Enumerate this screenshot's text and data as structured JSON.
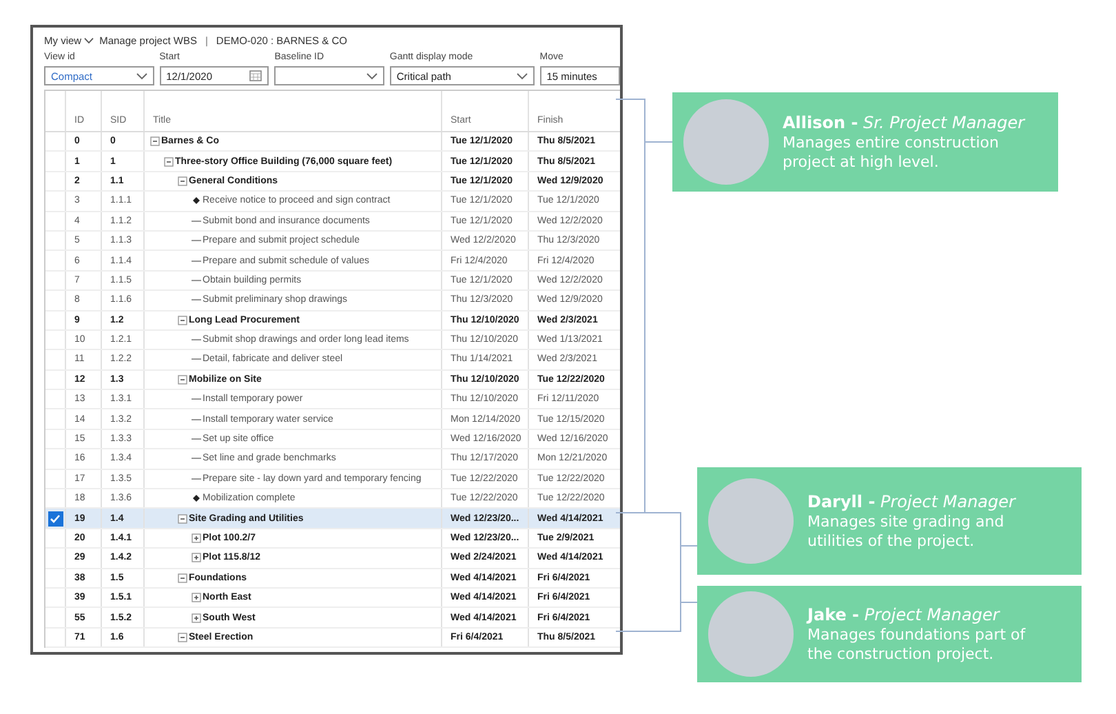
{
  "breadcrumb": {
    "view": "My view",
    "page": "Manage project WBS",
    "separator": "|",
    "record": "DEMO-020 : BARNES & CO"
  },
  "filters": [
    {
      "label": "View id",
      "value": "Compact",
      "kind": "dropdown"
    },
    {
      "label": "Start",
      "value": "12/1/2020",
      "kind": "date"
    },
    {
      "label": "Baseline ID",
      "kind": "dropdown"
    },
    {
      "label": "Gantt display mode",
      "value": "Critical path",
      "kind": "dropdown"
    },
    {
      "label": "Move",
      "value": "15 minutes",
      "kind": "text"
    }
  ],
  "columns": [
    "ID",
    "SID",
    "Title",
    "Start",
    "Finish"
  ],
  "tasks": [
    {
      "id": "0",
      "sid": "0",
      "title": "Barnes & Co",
      "start": "Tue 12/1/2020",
      "finish": "Thu 8/5/2021",
      "kind": "summary",
      "expanded": true,
      "selected": false,
      "children": [
        {
          "id": "1",
          "sid": "1",
          "title": "Three-story Office Building (76,000 square feet)",
          "start": "Tue 12/1/2020",
          "finish": "Thu 8/5/2021",
          "kind": "summary",
          "expanded": true,
          "selected": false,
          "children": [
            {
              "id": "2",
              "sid": "1.1",
              "title": "General Conditions",
              "start": "Tue 12/1/2020",
              "finish": "Wed 12/9/2020",
              "kind": "summary",
              "expanded": true,
              "selected": false,
              "children": [
                {
                  "id": "3",
                  "sid": "1.1.1",
                  "title": "Receive notice to proceed and sign contract",
                  "start": "Tue 12/1/2020",
                  "finish": "Tue 12/1/2020",
                  "kind": "milestone",
                  "selected": false
                },
                {
                  "id": "4",
                  "sid": "1.1.2",
                  "title": "Submit bond and insurance documents",
                  "start": "Tue 12/1/2020",
                  "finish": "Wed 12/2/2020",
                  "kind": "task",
                  "selected": false
                },
                {
                  "id": "5",
                  "sid": "1.1.3",
                  "title": "Prepare and submit project schedule",
                  "start": "Wed 12/2/2020",
                  "finish": "Thu 12/3/2020",
                  "kind": "task",
                  "selected": false
                },
                {
                  "id": "6",
                  "sid": "1.1.4",
                  "title": "Prepare and submit schedule of values",
                  "start": "Fri 12/4/2020",
                  "finish": "Fri 12/4/2020",
                  "kind": "task",
                  "selected": false
                },
                {
                  "id": "7",
                  "sid": "1.1.5",
                  "title": "Obtain building permits",
                  "start": "Tue 12/1/2020",
                  "finish": "Wed 12/2/2020",
                  "kind": "task",
                  "selected": false
                },
                {
                  "id": "8",
                  "sid": "1.1.6",
                  "title": "Submit preliminary shop drawings",
                  "start": "Thu 12/3/2020",
                  "finish": "Wed 12/9/2020",
                  "kind": "task",
                  "selected": false
                }
              ]
            },
            {
              "id": "9",
              "sid": "1.2",
              "title": "Long Lead Procurement",
              "start": "Thu 12/10/2020",
              "finish": "Wed 2/3/2021",
              "kind": "summary",
              "expanded": true,
              "selected": false,
              "children": [
                {
                  "id": "10",
                  "sid": "1.2.1",
                  "title": "Submit shop drawings and order long lead items",
                  "start": "Thu 12/10/2020",
                  "finish": "Wed 1/13/2021",
                  "kind": "task",
                  "selected": false
                },
                {
                  "id": "11",
                  "sid": "1.2.2",
                  "title": "Detail, fabricate and deliver steel",
                  "start": "Thu 1/14/2021",
                  "finish": "Wed 2/3/2021",
                  "kind": "task",
                  "selected": false
                }
              ]
            },
            {
              "id": "12",
              "sid": "1.3",
              "title": "Mobilize on Site",
              "start": "Thu 12/10/2020",
              "finish": "Tue 12/22/2020",
              "kind": "summary",
              "expanded": true,
              "selected": false,
              "children": [
                {
                  "id": "13",
                  "sid": "1.3.1",
                  "title": "Install temporary power",
                  "start": "Thu 12/10/2020",
                  "finish": "Fri 12/11/2020",
                  "kind": "task",
                  "selected": false
                },
                {
                  "id": "14",
                  "sid": "1.3.2",
                  "title": "Install temporary water service",
                  "start": "Mon 12/14/2020",
                  "finish": "Tue 12/15/2020",
                  "kind": "task",
                  "selected": false
                },
                {
                  "id": "15",
                  "sid": "1.3.3",
                  "title": "Set up site office",
                  "start": "Wed 12/16/2020",
                  "finish": "Wed 12/16/2020",
                  "kind": "task",
                  "selected": false
                },
                {
                  "id": "16",
                  "sid": "1.3.4",
                  "title": "Set line and grade benchmarks",
                  "start": "Thu 12/17/2020",
                  "finish": "Mon 12/21/2020",
                  "kind": "task",
                  "selected": false
                },
                {
                  "id": "17",
                  "sid": "1.3.5",
                  "title": "Prepare site - lay down yard and temporary fencing",
                  "start": "Tue 12/22/2020",
                  "finish": "Tue 12/22/2020",
                  "kind": "task",
                  "selected": false
                },
                {
                  "id": "18",
                  "sid": "1.3.6",
                  "title": "Mobilization complete",
                  "start": "Tue 12/22/2020",
                  "finish": "Tue 12/22/2020",
                  "kind": "milestone",
                  "selected": false
                }
              ]
            },
            {
              "id": "19",
              "sid": "1.4",
              "title": "Site Grading and Utilities",
              "start": "Wed 12/23/20...",
              "finish": "Wed 4/14/2021",
              "kind": "summary",
              "expanded": true,
              "selected": true,
              "children": [
                {
                  "id": "20",
                  "sid": "1.4.1",
                  "title": "Plot 100.2/7",
                  "start": "Wed 12/23/20...",
                  "finish": "Tue 2/9/2021",
                  "kind": "summary",
                  "expanded": false,
                  "selected": false
                },
                {
                  "id": "29",
                  "sid": "1.4.2",
                  "title": "Plot 115.8/12",
                  "start": "Wed 2/24/2021",
                  "finish": "Wed 4/14/2021",
                  "kind": "summary",
                  "expanded": false,
                  "selected": false
                }
              ]
            },
            {
              "id": "38",
              "sid": "1.5",
              "title": "Foundations",
              "start": "Wed 4/14/2021",
              "finish": "Fri 6/4/2021",
              "kind": "summary",
              "expanded": true,
              "selected": false,
              "children": [
                {
                  "id": "39",
                  "sid": "1.5.1",
                  "title": "North East",
                  "start": "Wed 4/14/2021",
                  "finish": "Fri 6/4/2021",
                  "kind": "summary",
                  "expanded": false,
                  "selected": false
                },
                {
                  "id": "55",
                  "sid": "1.5.2",
                  "title": "South West",
                  "start": "Wed 4/14/2021",
                  "finish": "Fri 6/4/2021",
                  "kind": "summary",
                  "expanded": false,
                  "selected": false
                }
              ]
            },
            {
              "id": "71",
              "sid": "1.6",
              "title": "Steel Erection",
              "start": "Fri 6/4/2021",
              "finish": "Thu 8/5/2021",
              "kind": "summary",
              "expanded": true,
              "selected": false
            }
          ]
        }
      ]
    }
  ],
  "managers": [
    {
      "heading": "**Allison -** *Sr. Project Manager*",
      "description": "Manages entire construction project at high level."
    },
    {
      "heading": "**Daryll -** *Project Manager*",
      "description": "Manages site grading and utilities of the project."
    },
    {
      "heading": "**Jake -** *Project Manager*",
      "description": "Manages foundations part of the construction project."
    }
  ]
}
